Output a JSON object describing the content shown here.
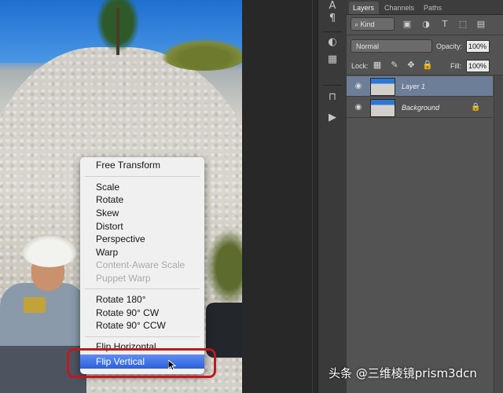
{
  "context_menu": {
    "items": [
      {
        "label": "Free Transform",
        "enabled": true
      },
      {
        "label": "Scale",
        "enabled": true
      },
      {
        "label": "Rotate",
        "enabled": true
      },
      {
        "label": "Skew",
        "enabled": true
      },
      {
        "label": "Distort",
        "enabled": true
      },
      {
        "label": "Perspective",
        "enabled": true
      },
      {
        "label": "Warp",
        "enabled": true
      },
      {
        "label": "Content-Aware Scale",
        "enabled": false
      },
      {
        "label": "Puppet Warp",
        "enabled": false
      },
      {
        "label": "Rotate 180°",
        "enabled": true
      },
      {
        "label": "Rotate 90° CW",
        "enabled": true
      },
      {
        "label": "Rotate 90° CCW",
        "enabled": true
      },
      {
        "label": "Flip Horizontal",
        "enabled": true
      },
      {
        "label": "Flip Vertical",
        "enabled": true,
        "selected": true
      }
    ],
    "highlight_color": "#c0181f"
  },
  "layers_panel": {
    "tabs": [
      {
        "label": "Layers",
        "active": true
      },
      {
        "label": "Channels",
        "active": false
      },
      {
        "label": "Paths",
        "active": false
      }
    ],
    "filter": {
      "kind_label": "Kind"
    },
    "blend_mode": "Normal",
    "opacity_label": "Opacity:",
    "opacity_value": "100%",
    "lock_label": "Lock:",
    "fill_label": "Fill:",
    "fill_value": "100%",
    "layers": [
      {
        "name": "Layer 1",
        "selected": true,
        "visible": true,
        "locked": false
      },
      {
        "name": "Background",
        "selected": false,
        "visible": true,
        "locked": true
      }
    ],
    "selected_row_color": "#6d7e98"
  },
  "watermark": "头条 @三维棱镜prism3dcn"
}
